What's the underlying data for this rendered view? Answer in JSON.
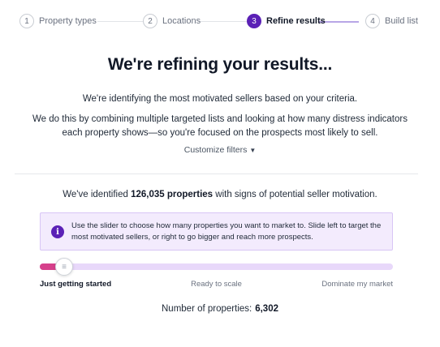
{
  "stepper": {
    "steps": [
      {
        "num": "1",
        "label": "Property types"
      },
      {
        "num": "2",
        "label": "Locations"
      },
      {
        "num": "3",
        "label": "Refine results"
      },
      {
        "num": "4",
        "label": "Build list"
      }
    ],
    "active_step": 3
  },
  "main": {
    "title": "We're refining your results...",
    "intro": "We're identifying the most motivated sellers based on your criteria.",
    "description": "We do this by combining multiple targeted lists and looking at how many distress indicators each property shows—so you're focused on the prospects most likely to sell.",
    "customize_label": "Customize filters",
    "identified_prefix": "We've identified ",
    "identified_count": "126,035 properties",
    "identified_suffix": " with signs of potential seller motivation."
  },
  "info": {
    "icon": "info-icon",
    "text": "Use the slider to choose how many properties you want to market to. Slide left to target the most motivated sellers, or right to go bigger and reach more prospects."
  },
  "slider": {
    "value_fraction": 0.06,
    "labels": {
      "left": "Just getting started",
      "middle": "Ready to scale",
      "right": "Dominate my market"
    },
    "colors": {
      "fill": "#d6408b",
      "track": "#e8d8fa"
    }
  },
  "result": {
    "label": "Number of properties:",
    "value": "6,302"
  },
  "colors": {
    "accent": "#5b21b6",
    "info_bg": "#f3ebfd"
  }
}
